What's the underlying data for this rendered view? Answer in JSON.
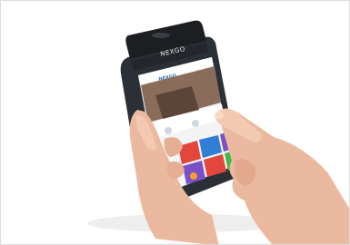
{
  "photo": {
    "subject": "hand-held-pos-terminal-with-finger-touching-screen",
    "brand_text": "NEXGO",
    "screen_logo": "NEXGO",
    "colors": {
      "background": "#ffffff",
      "device_body": "#2b2f36",
      "device_top": "#1c1e22",
      "skin": "#eab9a0",
      "tile_red": "#e2463c",
      "tile_blue": "#2f7fd6",
      "tile_purple": "#7b4fc8",
      "tile_green": "#43b649",
      "tile_orange": "#f2a12a"
    }
  }
}
